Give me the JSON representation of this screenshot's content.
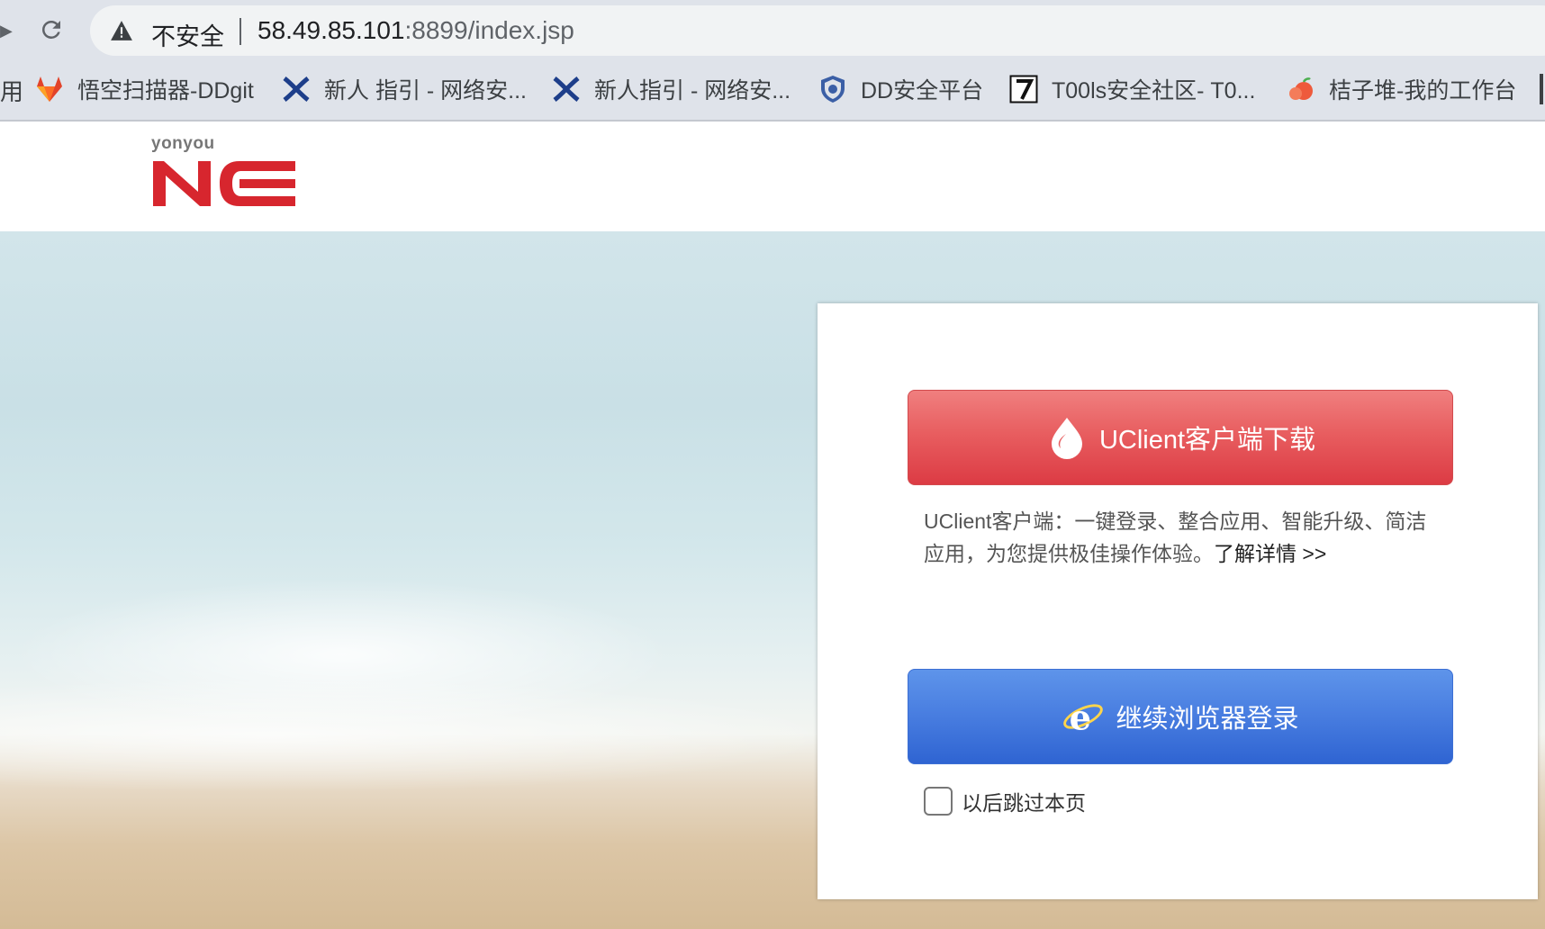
{
  "browser": {
    "security_label": "不安全",
    "url_host": "58.49.85.101",
    "url_rest": ":8899/index.jsp",
    "bookmarks_edge_char": "用",
    "bookmarks": [
      {
        "label": "悟空扫描器-DDgit",
        "icon": "gitlab-fox-icon"
      },
      {
        "label": "新人 指引 - 网络安...",
        "icon": "confluence-x-icon"
      },
      {
        "label": "新人指引 - 网络安...",
        "icon": "confluence-x-icon"
      },
      {
        "label": "DD安全平台",
        "icon": "shield-badge-icon"
      },
      {
        "label": "T00ls安全社区- T0...",
        "icon": "t00ls-seven-icon"
      },
      {
        "label": "桔子堆-我的工作台",
        "icon": "orange-icon"
      }
    ]
  },
  "header": {
    "logo_small": "yonyou",
    "logo_main": "NC"
  },
  "card": {
    "download_button": "UClient客户端下载",
    "description": "UClient客户端：一键登录、整合应用、智能升级、简洁应用，为您提供极佳操作体验。",
    "more_link": "了解详情 >>",
    "browser_login_button": "继续浏览器登录",
    "skip_checkbox_label": "以后跳过本页",
    "skip_checked": false
  },
  "colors": {
    "download_button": "#e0474d",
    "login_button": "#3d73dc",
    "logo_red": "#d7262e"
  }
}
